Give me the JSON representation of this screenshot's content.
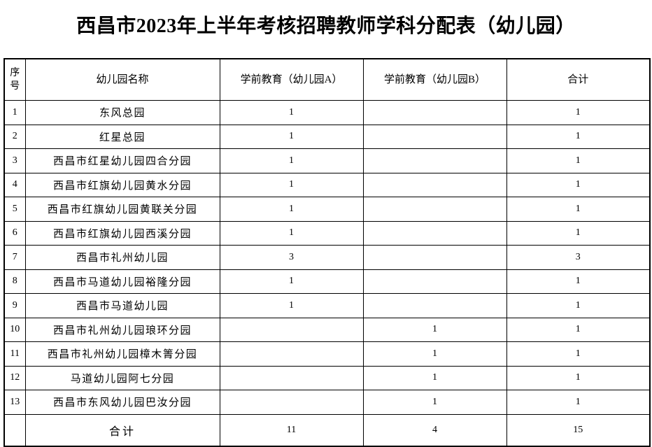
{
  "document": {
    "title": "西昌市2023年上半年考核招聘教师学科分配表（幼儿园）"
  },
  "table": {
    "columns": [
      {
        "key": "seq",
        "label": "序号"
      },
      {
        "key": "name",
        "label": "幼儿园名称"
      },
      {
        "key": "a",
        "label": "学前教育（幼儿园A）"
      },
      {
        "key": "b",
        "label": "学前教育（幼儿园B）"
      },
      {
        "key": "total",
        "label": "合计"
      }
    ],
    "rows": [
      {
        "seq": "1",
        "name": "东风总园",
        "a": "1",
        "b": "",
        "total": "1"
      },
      {
        "seq": "2",
        "name": "红星总园",
        "a": "1",
        "b": "",
        "total": "1"
      },
      {
        "seq": "3",
        "name": "西昌市红星幼儿园四合分园",
        "a": "1",
        "b": "",
        "total": "1"
      },
      {
        "seq": "4",
        "name": "西昌市红旗幼儿园黄水分园",
        "a": "1",
        "b": "",
        "total": "1"
      },
      {
        "seq": "5",
        "name": "西昌市红旗幼儿园黄联关分园",
        "a": "1",
        "b": "",
        "total": "1"
      },
      {
        "seq": "6",
        "name": "西昌市红旗幼儿园西溪分园",
        "a": "1",
        "b": "",
        "total": "1"
      },
      {
        "seq": "7",
        "name": "西昌市礼州幼儿园",
        "a": "3",
        "b": "",
        "total": "3"
      },
      {
        "seq": "8",
        "name": "西昌市马道幼儿园裕隆分园",
        "a": "1",
        "b": "",
        "total": "1"
      },
      {
        "seq": "9",
        "name": "西昌市马道幼儿园",
        "a": "1",
        "b": "",
        "total": "1"
      },
      {
        "seq": "10",
        "name": "西昌市礼州幼儿园琅环分园",
        "a": "",
        "b": "1",
        "total": "1"
      },
      {
        "seq": "11",
        "name": "西昌市礼州幼儿园樟木箐分园",
        "a": "",
        "b": "1",
        "total": "1"
      },
      {
        "seq": "12",
        "name": "马道幼儿园阿七分园",
        "a": "",
        "b": "1",
        "total": "1"
      },
      {
        "seq": "13",
        "name": "西昌市东风幼儿园巴汝分园",
        "a": "",
        "b": "1",
        "total": "1"
      }
    ],
    "total_row": {
      "seq": "",
      "label": "合计",
      "a": "11",
      "b": "4",
      "total": "15"
    }
  }
}
